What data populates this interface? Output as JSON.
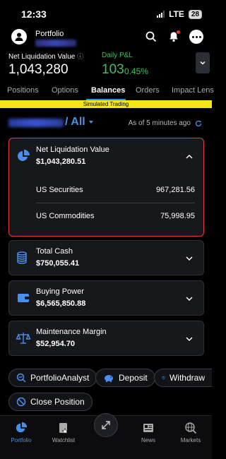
{
  "status": {
    "time": "12:33",
    "network": "LTE",
    "battery": "28"
  },
  "header": {
    "portfolio_label": "Portfolio"
  },
  "summary": {
    "nlv_label": "Net Liquidation Value",
    "nlv_value": "1,043,280",
    "daily_pl_label": "Daily P&L",
    "daily_pl_value": "103",
    "daily_pl_pct": "0.45%"
  },
  "tabs": [
    "Positions",
    "Options",
    "Balances",
    "Orders",
    "Impact Lens"
  ],
  "active_tab": "Balances",
  "banner": "Simulated Trading",
  "account": {
    "selector": "/ All",
    "as_of": "As of 5 minutes ago"
  },
  "cards": {
    "nlv": {
      "title": "Net Liquidation Value",
      "amount": "$1,043,280.51",
      "rows": [
        {
          "label": "US Securities",
          "value": "967,281.56"
        },
        {
          "label": "US Commodities",
          "value": "75,998.95"
        }
      ]
    },
    "cash": {
      "title": "Total Cash",
      "amount": "$750,055.41"
    },
    "buying_power": {
      "title": "Buying Power",
      "amount": "$6,565,850.88"
    },
    "margin": {
      "title": "Maintenance Margin",
      "amount": "$52,954.70"
    }
  },
  "actions": {
    "portfolio_analyst": "PortfolioAnalyst",
    "deposit": "Deposit",
    "withdraw": "Withdraw",
    "close_position": "Close Position"
  },
  "nav": {
    "portfolio": "Portfolio",
    "watchlist": "Watchlist",
    "news": "News",
    "markets": "Markets"
  },
  "colors": {
    "accent": "#4a90e2",
    "positive": "#3fbf5e",
    "banner": "#f5e51b",
    "highlight": "#e53935"
  }
}
